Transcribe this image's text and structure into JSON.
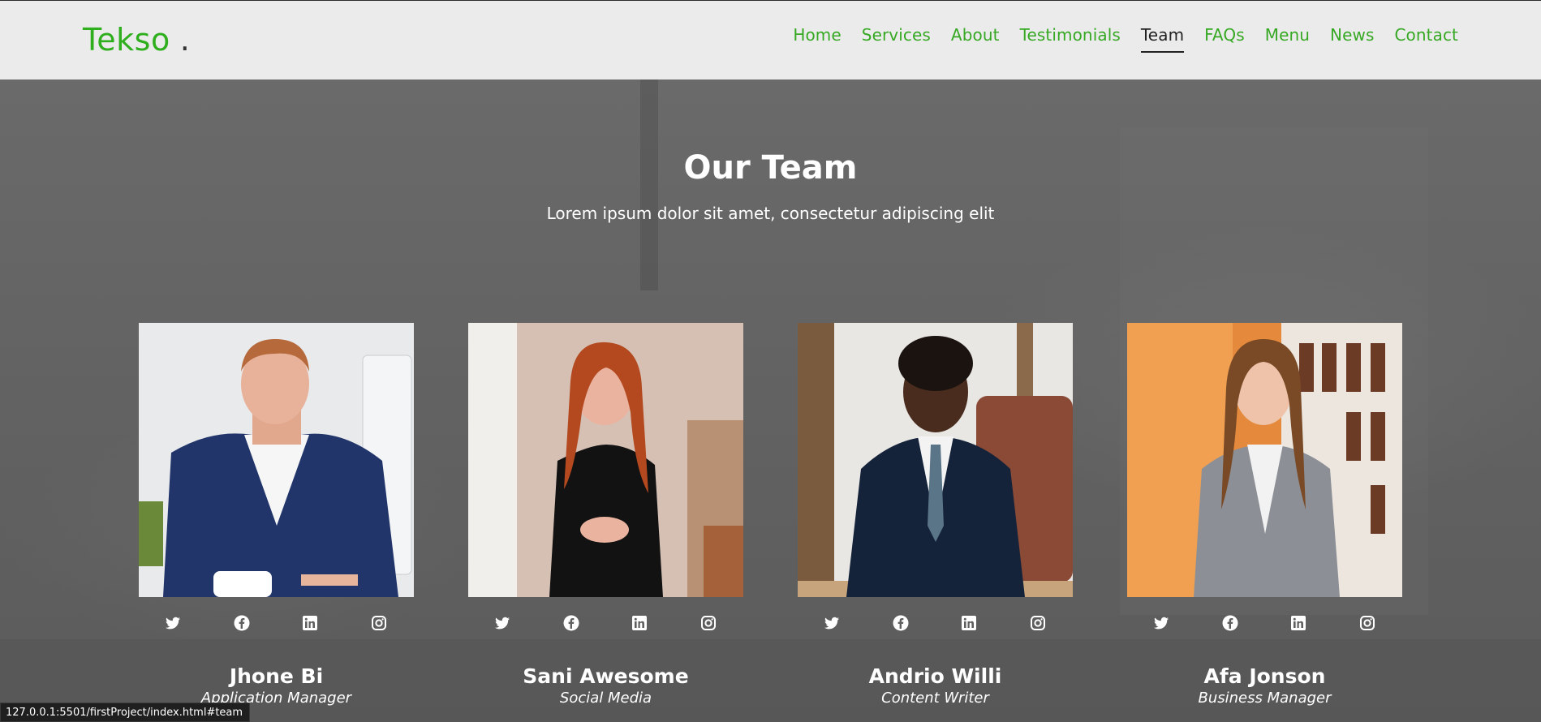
{
  "brand": {
    "name": "Tekso",
    "dot": "."
  },
  "nav": {
    "items": [
      {
        "label": "Home"
      },
      {
        "label": "Services"
      },
      {
        "label": "About"
      },
      {
        "label": "Testimonials"
      },
      {
        "label": "Team",
        "active": true
      },
      {
        "label": "FAQs"
      },
      {
        "label": "Menu"
      },
      {
        "label": "News"
      },
      {
        "label": "Contact"
      }
    ]
  },
  "team": {
    "title": "Our Team",
    "subtitle": "Lorem ipsum dolor sit amet, consectetur adipiscing elit",
    "members": [
      {
        "name": "Jhone Bi",
        "role": "Application Manager"
      },
      {
        "name": "Sani Awesome",
        "role": "Social Media"
      },
      {
        "name": "Andrio Willi",
        "role": "Content Writer"
      },
      {
        "name": "Afa Jonson",
        "role": "Business Manager"
      }
    ],
    "social_icons": [
      "twitter-icon",
      "facebook-icon",
      "linkedin-icon",
      "instagram-icon"
    ]
  },
  "status_bar": {
    "url": "127.0.0.1:5501/firstProject/index.html#team"
  },
  "colors": {
    "accent": "#2fae1e",
    "nav_bg": "#ebebeb",
    "overlay": "#5f5f5f"
  }
}
